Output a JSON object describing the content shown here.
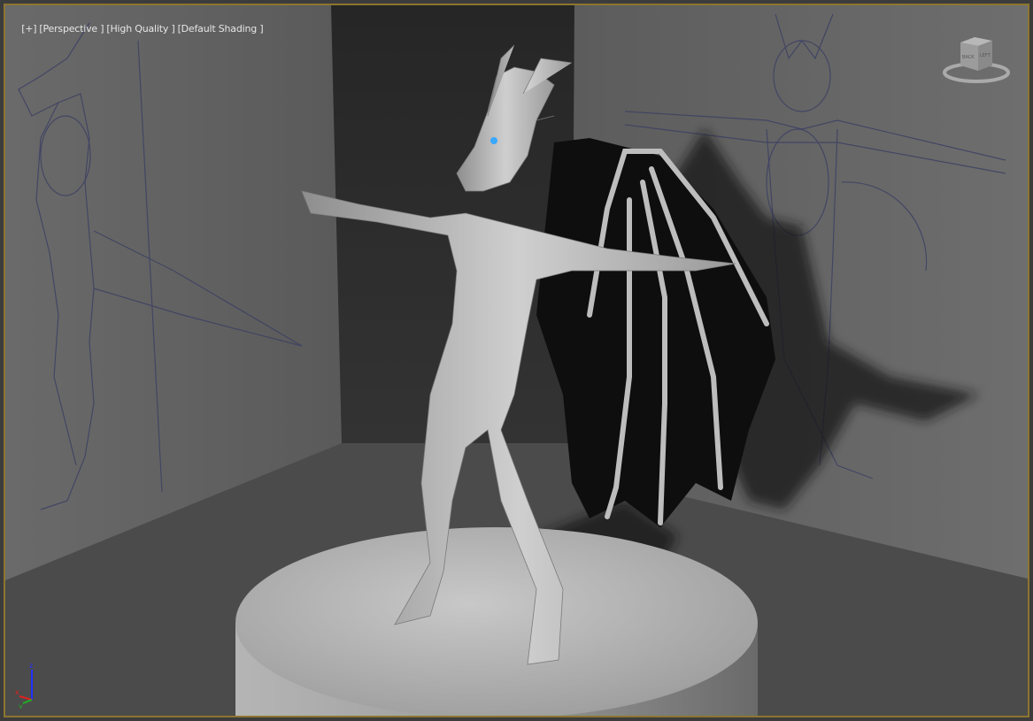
{
  "viewport": {
    "labels": {
      "menu": "[+]",
      "view": "[Perspective ]",
      "quality": "[High Quality ]",
      "shading": "[Default Shading ]"
    },
    "viewcube": {
      "front_face": "BACK",
      "side_face": "LEFT"
    },
    "axis_gizmo": {
      "x": "x",
      "y": "y",
      "z": "z"
    },
    "colors": {
      "border": "#8c7630",
      "axis_x": "#e02020",
      "axis_y": "#20b020",
      "axis_z": "#2030ff"
    }
  }
}
